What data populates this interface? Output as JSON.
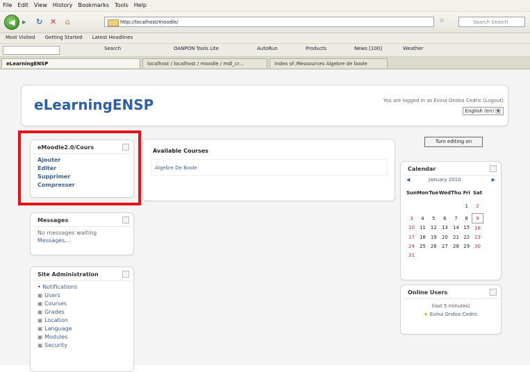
{
  "browser": {
    "menu": [
      "File",
      "Edit",
      "View",
      "History",
      "Bookmarks",
      "Tools",
      "Help"
    ],
    "url": "http://localhost/moodle/",
    "search_placeholder": "Search Search",
    "bookmarks": [
      "Most Visited",
      "Getting Started",
      "Latest Headlines"
    ],
    "toolbar_items": [
      "Search",
      "OANPON Tools Lite",
      "AutoRun",
      "Products",
      "News [100]",
      "Weather"
    ],
    "tabs": [
      {
        "label": "eLearningENSP",
        "active": true
      },
      {
        "label": "localhost / localhost / moodle / mdl_cr...",
        "active": false
      },
      {
        "label": "Index of /Ressources Algebre de boole",
        "active": false
      }
    ]
  },
  "header": {
    "site_title": "eLearningENSP",
    "logged_in_text": "You are logged in as Evina Ondoa Cedric (Logout)",
    "language": "English (en)"
  },
  "blocks": {
    "emoodle": {
      "title": "eMoodle2.0/Cours",
      "items": [
        "Ajouter",
        "Editer",
        "Supprimer",
        "Compresser"
      ]
    },
    "messages": {
      "title": "Messages",
      "text": "No messages waiting",
      "link": "Messages..."
    },
    "site_admin": {
      "title": "Site Administration",
      "items": [
        "Notifications",
        "Users",
        "Courses",
        "Grades",
        "Location",
        "Language",
        "Modules",
        "Security"
      ]
    },
    "available_courses": {
      "title": "Available Courses",
      "course": "Algebre De Boole"
    },
    "turn_editing": "Turn editing on",
    "calendar": {
      "title": "Calendar",
      "month": "January 2010",
      "weekdays": [
        "Sun",
        "Mon",
        "Tue",
        "Wed",
        "Thu",
        "Fri",
        "Sat"
      ],
      "weeks": [
        [
          "",
          "",
          "",
          "",
          "",
          "1",
          "2"
        ],
        [
          "3",
          "4",
          "5",
          "6",
          "7",
          "8",
          "9"
        ],
        [
          "10",
          "11",
          "12",
          "13",
          "14",
          "15",
          "16"
        ],
        [
          "17",
          "18",
          "19",
          "20",
          "21",
          "22",
          "23"
        ],
        [
          "24",
          "25",
          "26",
          "27",
          "28",
          "29",
          "30"
        ],
        [
          "31",
          "",
          "",
          "",
          "",
          "",
          ""
        ]
      ]
    },
    "online_users": {
      "title": "Online Users",
      "subtitle": "(last 5 minutes)",
      "user": "Evina Ondoa Cedric"
    }
  },
  "colors": {
    "highlight": "#e2141a",
    "site_title": "#2f5fa0",
    "link": "#3a5f8c"
  }
}
